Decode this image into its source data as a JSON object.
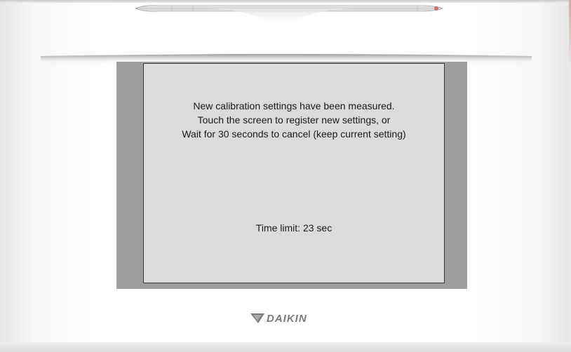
{
  "screen": {
    "message_lines": [
      "New calibration settings have been measured.",
      "Touch the screen to register new settings, or",
      "Wait for 30 seconds to cancel (keep current setting)"
    ],
    "time_limit": "Time limit: 23 sec"
  },
  "brand": {
    "logo_text": "DAIKIN",
    "logo_icon": "daikin-logo-icon"
  },
  "device": {
    "stylus_icon": "stylus-icon"
  },
  "colors": {
    "screen_bg": "#dadbdc",
    "frame": "#9e9e9e",
    "text": "#1a1a1a",
    "logo": "#7a7a7a"
  }
}
